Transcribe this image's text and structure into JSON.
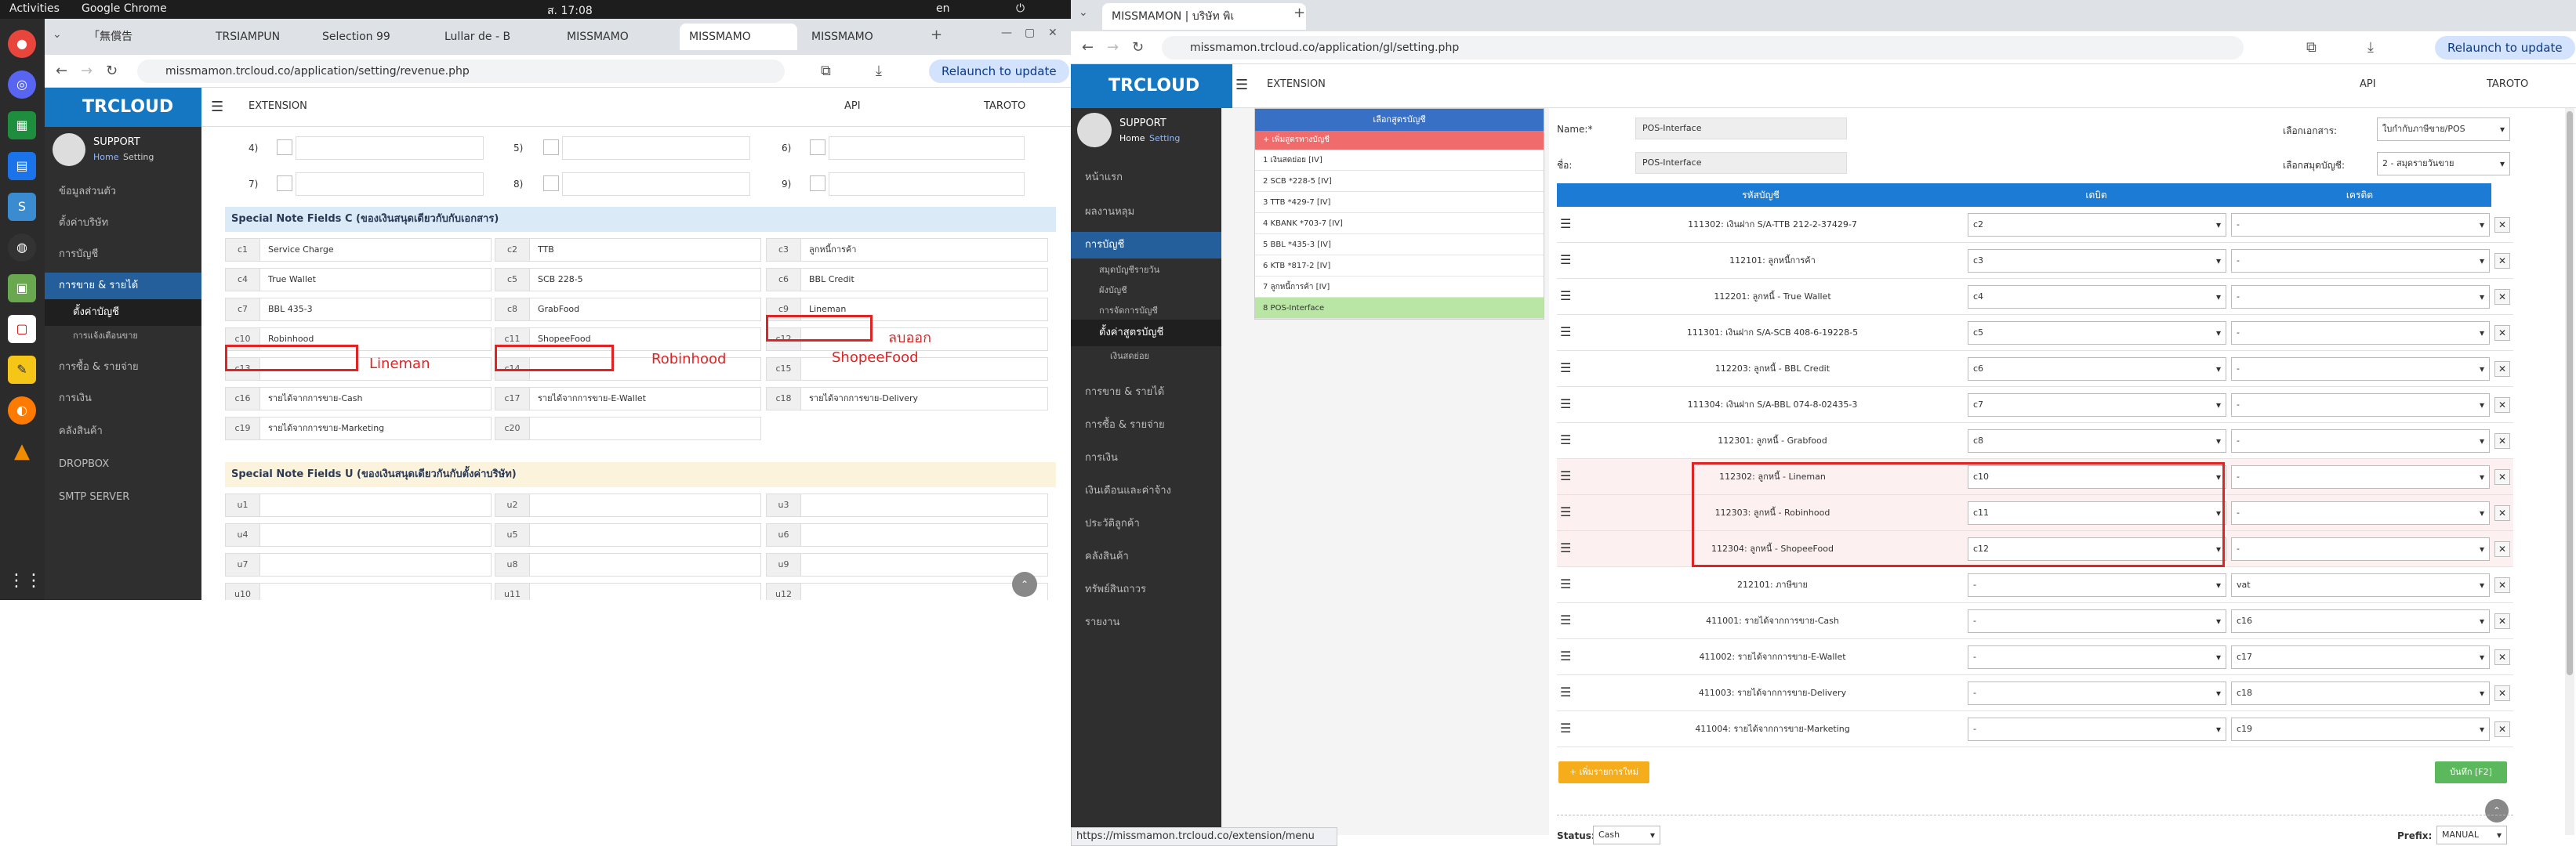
{
  "top_bar": {
    "activities": "Activities",
    "app": "Google Chrome",
    "clock": "ส. 17:08",
    "lang": "en"
  },
  "left_window": {
    "tabs": [
      "「無償告",
      "TRSIAMPUN",
      "Selection 99",
      "Lullar de - B",
      "MISSMAMO",
      "MISSMAMO",
      "MISSMAMO"
    ],
    "url": "missmamon.trcloud.co/application/setting/revenue.php",
    "relaunch": "Relaunch to update",
    "header": {
      "logo": "TRCLOUD",
      "extension": "EXTENSION",
      "api": "API",
      "user": "TAROTO"
    },
    "profile": {
      "name": "SUPPORT",
      "home": "Home",
      "setting": "Setting"
    },
    "sidebar": [
      "ข้อมูลส่วนตัว",
      "ตั้งค่าบริษัท",
      "การบัญชี",
      "การขาย & รายได้",
      "ตั้งค่าบัญชี",
      "การแจ้งเตือนขาย",
      "การซื้อ & รายจ่าย",
      "การเงิน",
      "คลังสินค้า",
      "DROPBOX",
      "SMTP SERVER"
    ],
    "top_rows": [
      "4)",
      "5)",
      "6)",
      "7)",
      "8)",
      "9)"
    ],
    "section_c": "Special Note Fields C (ของเงินสนุดเดียวกับกับเอกสาร)",
    "section_u": "Special Note Fields U (ของเงินสนุดเดียวกันกับตั้งค่าบริษัท)",
    "c_fields": [
      [
        "c1",
        "Service Charge"
      ],
      [
        "c2",
        "TTB"
      ],
      [
        "c3",
        "ลูกหนี้การค้า"
      ],
      [
        "c4",
        "True Wallet"
      ],
      [
        "c5",
        "SCB 228-5"
      ],
      [
        "c6",
        "BBL Credit"
      ],
      [
        "c7",
        "BBL 435-3"
      ],
      [
        "c8",
        "GrabFood"
      ],
      [
        "c9",
        "Lineman"
      ],
      [
        "c10",
        "Robinhood"
      ],
      [
        "c11",
        "ShopeeFood"
      ],
      [
        "c12",
        ""
      ],
      [
        "c13",
        ""
      ],
      [
        "c14",
        ""
      ],
      [
        "c15",
        ""
      ],
      [
        "c16",
        "รายได้จากการขาย-Cash"
      ],
      [
        "c17",
        "รายได้จากการขาย-E-Wallet"
      ],
      [
        "c18",
        "รายได้จากการขาย-Delivery"
      ],
      [
        "c19",
        "รายได้จากการขาย-Marketing"
      ],
      [
        "c20",
        ""
      ]
    ],
    "u_fields": [
      "u1",
      "u2",
      "u3",
      "u4",
      "u5",
      "u6",
      "u7",
      "u8",
      "u9",
      "u10",
      "u11",
      "u12"
    ],
    "annotations": {
      "lineman": "Lineman",
      "robinhood": "Robinhood",
      "shopeefood": "ShopeeFood",
      "delete": "ลบออก"
    }
  },
  "right_window": {
    "tab": "MISSMAMON | บริษัท พิเ",
    "url": "missmamon.trcloud.co/application/gl/setting.php",
    "relaunch": "Relaunch to update",
    "header": {
      "logo": "TRCLOUD",
      "extension": "EXTENSION",
      "api": "API",
      "user": "TAROTO"
    },
    "profile": {
      "name": "SUPPORT",
      "home": "Home",
      "setting": "Setting"
    },
    "sidebar": [
      "หน้าแรก",
      "ผลงานหลุม",
      "การบัญชี",
      "สมุดบัญชีรายวัน",
      "ผังบัญชี",
      "การจัดการบัญชี",
      "ตั้งค่าสูตรบัญชี",
      "เงินสดย่อย",
      "การขาย & รายได้",
      "การซื้อ & รายจ่าย",
      "การเงิน",
      "เงินเดือนและค่าจ้าง",
      "ประวัติลูกค้า",
      "คลังสินค้า",
      "ทรัพย์สินถาวร",
      "รายงาน"
    ],
    "formula_panel": {
      "title": "เลือกสูตรบัญชี",
      "add": "+ เพิ่มสูตรทางบัญชี",
      "items": [
        "1 เงินสดย่อย [IV]",
        "2 SCB *228-5 [IV]",
        "3 TTB *429-7 [IV]",
        "4 KBANK *703-7 [IV]",
        "5 BBL *435-3 [IV]",
        "6 KTB *817-2 [IV]",
        "7 ลูกหนี้การค้า [IV]",
        "8 POS-Interface"
      ]
    },
    "form": {
      "name_label": "Name:*",
      "name_value": "POS-Interface",
      "alias_label": "ชื่อ:",
      "alias_value": "POS-Interface",
      "doc_label": "เลือกเอกสาร:",
      "doc_value": "ใบกำกับภาษีขาย/POS",
      "book_label": "เลือกสมุดบัญชี:",
      "book_value": "2 - สมุดรายวันขาย"
    },
    "table_headers": [
      "รหัสบัญชี",
      "เดบิต",
      "เครดิต"
    ],
    "rows": [
      [
        "111302: เงินฝาก S/A-TTB 212-2-37429-7",
        "c2",
        "-"
      ],
      [
        "112101: ลูกหนี้การค้า",
        "c3",
        "-"
      ],
      [
        "112201: ลูกหนี้ - True Wallet",
        "c4",
        "-"
      ],
      [
        "111301: เงินฝาก S/A-SCB 408-6-19228-5",
        "c5",
        "-"
      ],
      [
        "112203: ลูกหนี้ - BBL Credit",
        "c6",
        "-"
      ],
      [
        "111304: เงินฝาก S/A-BBL 074-8-02435-3",
        "c7",
        "-"
      ],
      [
        "112301: ลูกหนี้ - Grabfood",
        "c8",
        "-"
      ],
      [
        "112302: ลูกหนี้ - Lineman",
        "c10",
        "-"
      ],
      [
        "112303: ลูกหนี้ - Robinhood",
        "c11",
        "-"
      ],
      [
        "112304: ลูกหนี้ - ShopeeFood",
        "c12",
        "-"
      ],
      [
        "212101: ภาษีขาย",
        "-",
        "vat"
      ],
      [
        "411001: รายได้จากการขาย-Cash",
        "-",
        "c16"
      ],
      [
        "411002: รายได้จากการขาย-E-Wallet",
        "-",
        "c17"
      ],
      [
        "411003: รายได้จากการขาย-Delivery",
        "-",
        "c18"
      ],
      [
        "411004: รายได้จากการขาย-Marketing",
        "-",
        "c19"
      ]
    ],
    "add_row": "+ เพิ่มรายการใหม่",
    "save": "บันทึก [F2]",
    "status_label": "Status:",
    "status_value": "Cash",
    "prefix_label": "Prefix:",
    "prefix_value": "MANUAL",
    "status_url": "https://missmamon.trcloud.co/extension/menu"
  }
}
